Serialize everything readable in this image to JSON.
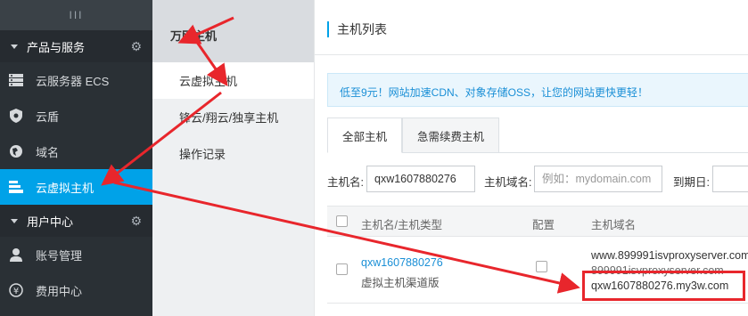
{
  "sidebar": {
    "collapse_label": "III",
    "sections": [
      {
        "label": "产品与服务"
      },
      {
        "label": "用户中心"
      }
    ],
    "products": [
      {
        "label": "云服务器 ECS",
        "icon": "server-icon"
      },
      {
        "label": "云盾",
        "icon": "shield-icon"
      },
      {
        "label": "域名",
        "icon": "globe-icon"
      },
      {
        "label": "云虚拟主机",
        "icon": "virtual-host-icon"
      }
    ],
    "user": [
      {
        "label": "账号管理",
        "icon": "user-icon"
      },
      {
        "label": "费用中心",
        "icon": "yen-icon"
      }
    ]
  },
  "subnav": {
    "title": "万网主机",
    "items": [
      {
        "label": "云虚拟主机"
      },
      {
        "label": "锋云/翔云/独享主机"
      },
      {
        "label": "操作记录"
      }
    ]
  },
  "main": {
    "title": "主机列表",
    "notice": "低至9元！网站加速CDN、对象存储OSS，让您的网站更快更轻！",
    "tabs": [
      {
        "label": "全部主机"
      },
      {
        "label": "急需续费主机"
      }
    ],
    "filters": {
      "host_label": "主机名:",
      "host_value": "qxw1607880276",
      "domain_label": "主机域名:",
      "domain_placeholder": "例如：mydomain.com",
      "expire_label": "到期日:"
    },
    "table": {
      "headers": {
        "name": "主机名/主机类型",
        "config": "配置",
        "domain": "主机域名"
      },
      "row": {
        "name": "qxw1607880276",
        "type": "虚拟主机渠道版",
        "domain_1": "www.899991isvproxyserver.com",
        "domain_2": "899991isvproxyserver.com",
        "domain_3": "qxw1607880276.my3w.com"
      }
    }
  },
  "colors": {
    "accent": "#00a2e8",
    "sidebar_bg": "#2a3035",
    "annotation_red": "#e8262c"
  }
}
